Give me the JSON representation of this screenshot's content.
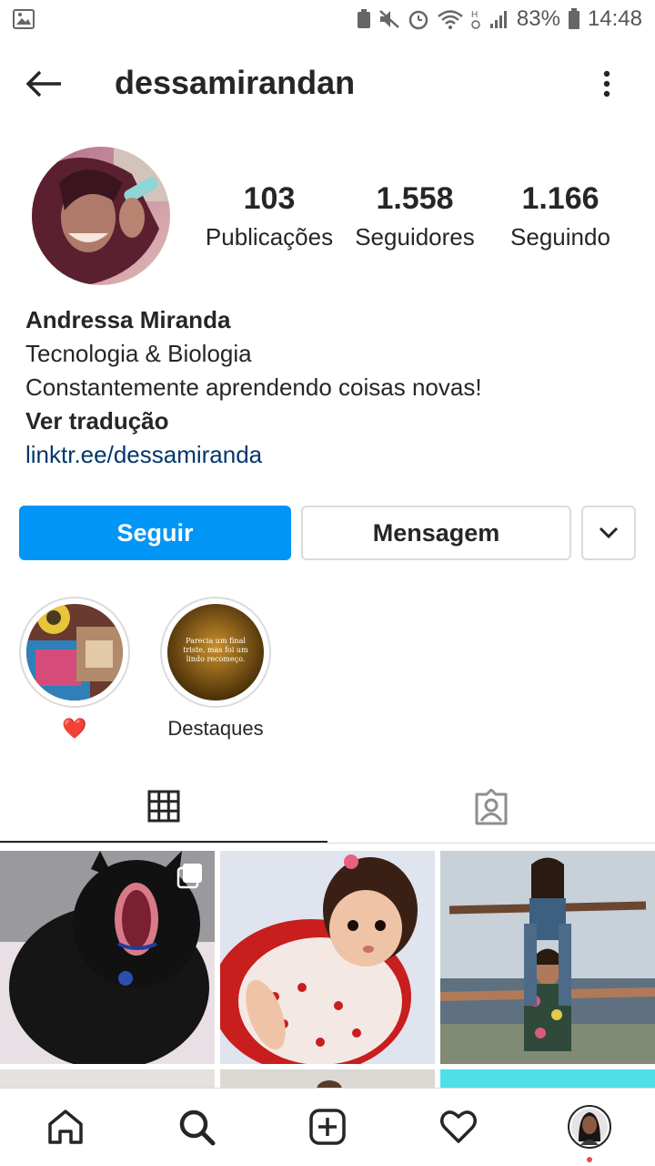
{
  "status_bar": {
    "battery": "83%",
    "time": "14:48"
  },
  "header": {
    "username": "dessamirandan"
  },
  "profile": {
    "stats": [
      {
        "value": "103",
        "label": "Publicações"
      },
      {
        "value": "1.558",
        "label": "Seguidores"
      },
      {
        "value": "1.166",
        "label": "Seguindo"
      }
    ],
    "bio": {
      "name": "Andressa Miranda",
      "line1": "Tecnologia & Biologia",
      "line2": "Constantemente aprendendo coisas novas!",
      "translate": "Ver tradução",
      "link": "linktr.ee/dessamiranda"
    }
  },
  "actions": {
    "follow_label": "Seguir",
    "message_label": "Mensagem"
  },
  "highlights": [
    {
      "label": "❤️",
      "story_text": ""
    },
    {
      "label": "Destaques",
      "story_text": "Parecia um final triste, mas foi um lindo recomeço."
    }
  ],
  "colors": {
    "accent": "#0095f6",
    "link": "#00376b",
    "text": "#262626",
    "border": "#dbdbdb",
    "notification_dot": "#ed4956"
  },
  "icons": {
    "back": "arrow-left-icon",
    "more": "vertical-dots-icon",
    "grid": "grid-icon",
    "tagged": "tagged-person-icon",
    "home": "home-icon",
    "search": "search-icon",
    "new_post": "plus-square-icon",
    "activity": "heart-icon",
    "profile": "avatar-icon"
  }
}
